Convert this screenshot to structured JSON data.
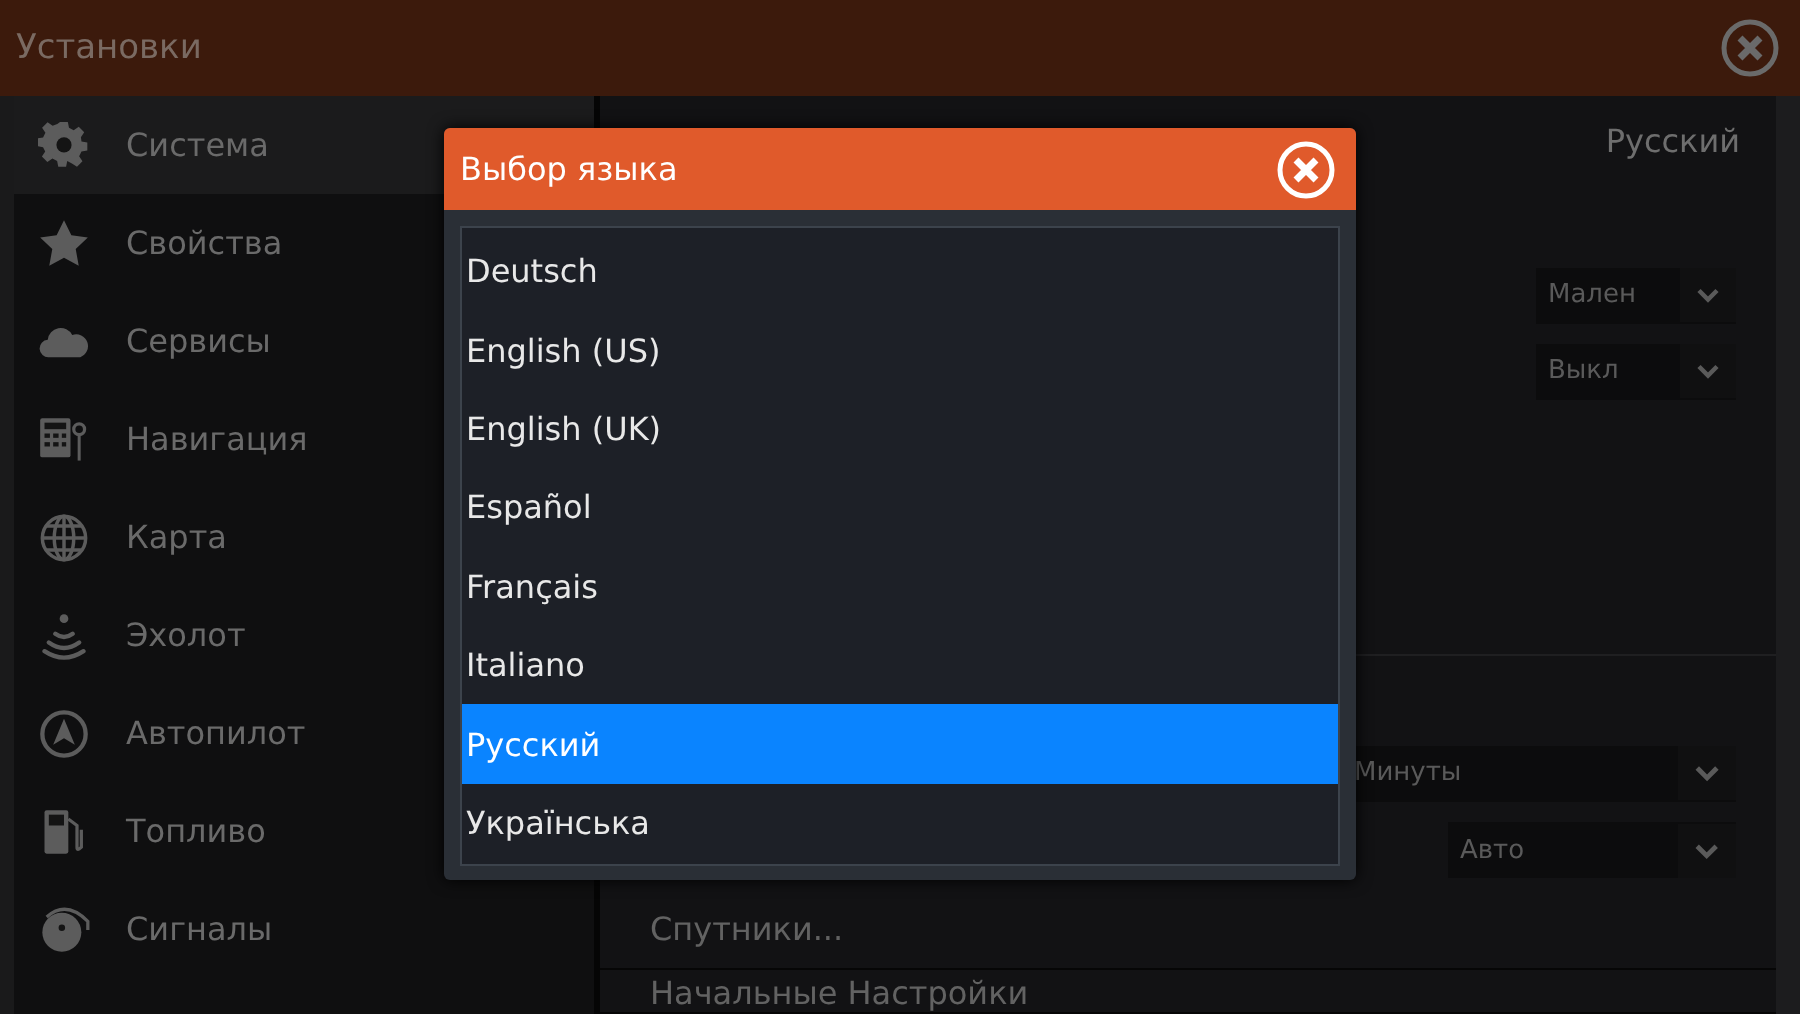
{
  "window": {
    "title": "Установки"
  },
  "sidebar": {
    "items": [
      {
        "label": "Система",
        "selected": true
      },
      {
        "label": "Свойства",
        "selected": false
      },
      {
        "label": "Сервисы",
        "selected": false
      },
      {
        "label": "Навигация",
        "selected": false
      },
      {
        "label": "Карта",
        "selected": false
      },
      {
        "label": "Эхолот",
        "selected": false
      },
      {
        "label": "Автопилот",
        "selected": false
      },
      {
        "label": "Топливо",
        "selected": false
      },
      {
        "label": "Сигналы",
        "selected": false
      }
    ]
  },
  "settings": {
    "language_value": "Русский",
    "dropdowns_top": [
      {
        "value": "Мален"
      },
      {
        "value": "Выкл"
      }
    ],
    "dropdowns_bottom": [
      {
        "value": "Минуты"
      },
      {
        "value": "Авто"
      }
    ],
    "rows": [
      {
        "label": "Спутники..."
      },
      {
        "label": "Начальные Настройки"
      }
    ]
  },
  "dialog": {
    "title": "Выбор языка",
    "options": [
      {
        "label": "Deutsch",
        "selected": false
      },
      {
        "label": "English (US)",
        "selected": false
      },
      {
        "label": "English (UK)",
        "selected": false
      },
      {
        "label": "Español",
        "selected": false
      },
      {
        "label": "Français",
        "selected": false
      },
      {
        "label": "Italiano",
        "selected": false
      },
      {
        "label": "Русский",
        "selected": true
      },
      {
        "label": "Українська",
        "selected": false
      }
    ]
  }
}
